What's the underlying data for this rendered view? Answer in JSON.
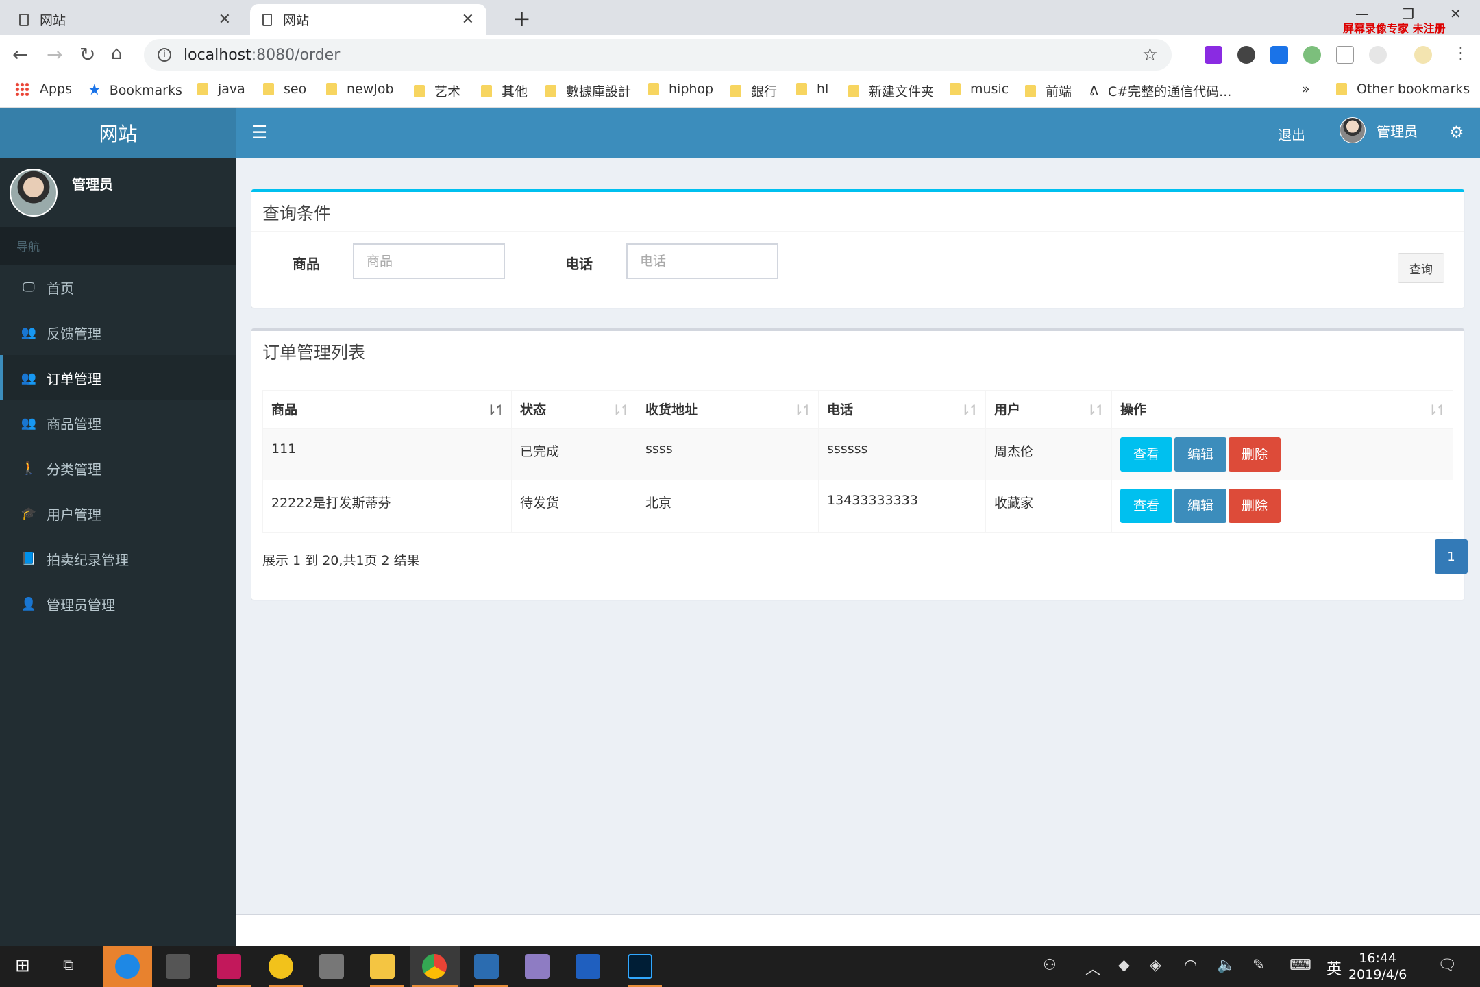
{
  "browser": {
    "tabs": [
      {
        "title": "网站",
        "active": false
      },
      {
        "title": "网站",
        "active": true
      }
    ],
    "new_tab": "+",
    "recorder_label": "屏幕录像专家  未注册",
    "url_host": "localhost",
    "url_path": ":8080/order",
    "bookmarks": [
      "Apps",
      "Bookmarks",
      "java",
      "seo",
      "newJob",
      "艺术",
      "其他",
      "數據庫設計",
      "hiphop",
      "銀行",
      "hl",
      "新建文件夹",
      "music",
      "前端",
      "C#完整的通信代码...",
      "»",
      "Other bookmarks"
    ]
  },
  "app": {
    "logo": "网站",
    "navbar": {
      "logout": "退出",
      "user_name": "管理员"
    },
    "sidebar": {
      "user_name": "管理员",
      "nav_header": "导航",
      "items": [
        {
          "label": "首页",
          "icon": "monitor-icon"
        },
        {
          "label": "反馈管理",
          "icon": "users-icon"
        },
        {
          "label": "订单管理",
          "icon": "users-icon",
          "active": true
        },
        {
          "label": "商品管理",
          "icon": "users-icon"
        },
        {
          "label": "分类管理",
          "icon": "person-icon"
        },
        {
          "label": "用户管理",
          "icon": "graduation-cap-icon"
        },
        {
          "label": "拍卖纪录管理",
          "icon": "book-icon"
        },
        {
          "label": "管理员管理",
          "icon": "user-icon"
        }
      ]
    },
    "search_box": {
      "title": "查询条件",
      "product_label": "商品",
      "product_placeholder": "商品",
      "phone_label": "电话",
      "phone_placeholder": "电话",
      "query_button": "查询"
    },
    "order_list": {
      "title": "订单管理列表",
      "columns": [
        "商品",
        "状态",
        "收货地址",
        "电话",
        "用户",
        "操作"
      ],
      "rows": [
        {
          "product": "111",
          "status": "已完成",
          "address": "ssss",
          "phone": "ssssss",
          "user": "周杰伦"
        },
        {
          "product": "22222是打发斯蒂芬",
          "status": "待发货",
          "address": "北京",
          "phone": "13433333333",
          "user": "收藏家"
        }
      ],
      "actions": {
        "view": "查看",
        "edit": "编辑",
        "delete": "删除"
      },
      "pager_info": "展示 1 到 20,共1页 2 结果",
      "current_page": "1"
    }
  },
  "taskbar": {
    "ime": "英",
    "time": "16:44",
    "date": "2019/4/6"
  },
  "colors": {
    "brand_header": "#3c8dbc",
    "logo_bg": "#367fa9",
    "sidebar_bg": "#222d32",
    "info_button": "#00c0ef",
    "primary_button": "#3c8dbc",
    "danger_button": "#dd4b39"
  }
}
